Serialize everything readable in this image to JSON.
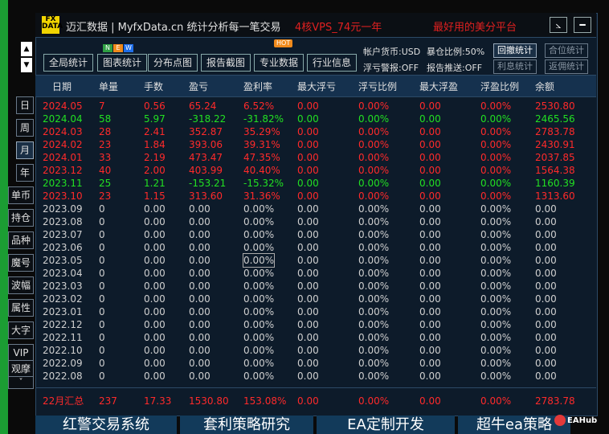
{
  "titlebar": {
    "logo_top": "FX",
    "logo_bottom": "DATA",
    "title": "迈汇数据 | MyfxData.cn   统计分析每一笔交易",
    "ad1": "4核VPS_74元一年",
    "ad2": "最好用的美分平台",
    "btn_resize": "⦣",
    "btn_minimize": "━"
  },
  "toolbar": {
    "buttons": [
      "全局统计",
      "图表统计",
      "分布点图",
      "报告截图",
      "专业数据",
      "行业信息"
    ],
    "new_badge": [
      "N",
      "E",
      "W"
    ],
    "hot_badge": "HOT",
    "currency": "帐户货币:USD",
    "explosion": "暴仓比例:50%",
    "float_alert": "浮亏警报:OFF",
    "report_push": "报告推送:OFF",
    "right_buttons": [
      "回撤统计",
      "合位统计",
      "利息统计",
      "返佣统计"
    ]
  },
  "side": {
    "arrow_up": "▲",
    "arrow_down": "▼",
    "period_buttons": [
      "日",
      "周",
      "月",
      "年"
    ],
    "menu_buttons": [
      "单币",
      "持仓",
      "品种",
      "魔号",
      "波幅",
      "属性",
      "大字",
      "VIP",
      "观摩"
    ],
    "scroll_down": "˅"
  },
  "table": {
    "headers": [
      "日期",
      "单量",
      "手数",
      "盈亏",
      "盈利率",
      "最大浮亏",
      "浮亏比例",
      "最大浮盈",
      "浮盈比例",
      "余额"
    ],
    "rows": [
      {
        "type": "pos",
        "c": [
          "2024.05",
          "7",
          "0.56",
          "65.24",
          "6.52%",
          "0.00",
          "0.00%",
          "0.00",
          "0.00%",
          "2530.80"
        ]
      },
      {
        "type": "neg",
        "c": [
          "2024.04",
          "58",
          "5.97",
          "-318.22",
          "-31.82%",
          "0.00",
          "0.00%",
          "0.00",
          "0.00%",
          "2465.56"
        ]
      },
      {
        "type": "pos",
        "c": [
          "2024.03",
          "28",
          "2.41",
          "352.87",
          "35.29%",
          "0.00",
          "0.00%",
          "0.00",
          "0.00%",
          "2783.78"
        ]
      },
      {
        "type": "pos",
        "c": [
          "2024.02",
          "23",
          "1.84",
          "393.06",
          "39.31%",
          "0.00",
          "0.00%",
          "0.00",
          "0.00%",
          "2430.91"
        ]
      },
      {
        "type": "pos",
        "c": [
          "2024.01",
          "33",
          "2.19",
          "473.47",
          "47.35%",
          "0.00",
          "0.00%",
          "0.00",
          "0.00%",
          "2037.85"
        ]
      },
      {
        "type": "pos",
        "c": [
          "2023.12",
          "40",
          "2.00",
          "403.99",
          "40.40%",
          "0.00",
          "0.00%",
          "0.00",
          "0.00%",
          "1564.38"
        ]
      },
      {
        "type": "neg",
        "c": [
          "2023.11",
          "25",
          "1.21",
          "-153.21",
          "-15.32%",
          "0.00",
          "0.00%",
          "0.00",
          "0.00%",
          "1160.39"
        ]
      },
      {
        "type": "pos",
        "c": [
          "2023.10",
          "23",
          "1.15",
          "313.60",
          "31.36%",
          "0.00",
          "0.00%",
          "0.00",
          "0.00%",
          "1313.60"
        ]
      },
      {
        "type": "zero",
        "c": [
          "2023.09",
          "0",
          "0.00",
          "0.00",
          "0.00%",
          "0.00",
          "0.00%",
          "0.00",
          "0.00%",
          "0.00"
        ]
      },
      {
        "type": "zero",
        "c": [
          "2023.08",
          "0",
          "0.00",
          "0.00",
          "0.00%",
          "0.00",
          "0.00%",
          "0.00",
          "0.00%",
          "0.00"
        ]
      },
      {
        "type": "zero",
        "c": [
          "2023.07",
          "0",
          "0.00",
          "0.00",
          "0.00%",
          "0.00",
          "0.00%",
          "0.00",
          "0.00%",
          "0.00"
        ]
      },
      {
        "type": "zero",
        "c": [
          "2023.06",
          "0",
          "0.00",
          "0.00",
          "0.00%",
          "0.00",
          "0.00%",
          "0.00",
          "0.00%",
          "0.00"
        ]
      },
      {
        "type": "zero",
        "c": [
          "2023.05",
          "0",
          "0.00",
          "0.00",
          "0.00%",
          "0.00",
          "0.00%",
          "0.00",
          "0.00%",
          "0.00"
        ]
      },
      {
        "type": "zero",
        "c": [
          "2023.04",
          "0",
          "0.00",
          "0.00",
          "0.00%",
          "0.00",
          "0.00%",
          "0.00",
          "0.00%",
          "0.00"
        ]
      },
      {
        "type": "zero",
        "c": [
          "2023.03",
          "0",
          "0.00",
          "0.00",
          "0.00%",
          "0.00",
          "0.00%",
          "0.00",
          "0.00%",
          "0.00"
        ]
      },
      {
        "type": "zero",
        "c": [
          "2023.02",
          "0",
          "0.00",
          "0.00",
          "0.00%",
          "0.00",
          "0.00%",
          "0.00",
          "0.00%",
          "0.00"
        ]
      },
      {
        "type": "zero",
        "c": [
          "2023.01",
          "0",
          "0.00",
          "0.00",
          "0.00%",
          "0.00",
          "0.00%",
          "0.00",
          "0.00%",
          "0.00"
        ]
      },
      {
        "type": "zero",
        "c": [
          "2022.12",
          "0",
          "0.00",
          "0.00",
          "0.00%",
          "0.00",
          "0.00%",
          "0.00",
          "0.00%",
          "0.00"
        ]
      },
      {
        "type": "zero",
        "c": [
          "2022.11",
          "0",
          "0.00",
          "0.00",
          "0.00%",
          "0.00",
          "0.00%",
          "0.00",
          "0.00%",
          "0.00"
        ]
      },
      {
        "type": "zero",
        "c": [
          "2022.10",
          "0",
          "0.00",
          "0.00",
          "0.00%",
          "0.00",
          "0.00%",
          "0.00",
          "0.00%",
          "0.00"
        ]
      },
      {
        "type": "zero",
        "c": [
          "2022.09",
          "0",
          "0.00",
          "0.00",
          "0.00%",
          "0.00",
          "0.00%",
          "0.00",
          "0.00%",
          "0.00"
        ]
      },
      {
        "type": "zero",
        "c": [
          "2022.08",
          "0",
          "0.00",
          "0.00",
          "0.00%",
          "0.00",
          "0.00%",
          "0.00",
          "0.00%",
          "0.00"
        ]
      }
    ],
    "summary": [
      "22月汇总",
      "237",
      "17.33",
      "1530.80",
      "153.08%",
      "0.00",
      "0.00%",
      "0.00",
      "0.00%",
      "2783.78"
    ]
  },
  "banners": [
    "红警交易系统",
    "套利策略研究",
    "EA定制开发",
    "超牛ea策略"
  ],
  "watermark": "EAHub",
  "colors": {
    "positive": "#ff2a2a",
    "negative": "#22e022",
    "neutral": "#cfcfcf",
    "panel": "#0d1b2a",
    "header": "#15314e"
  }
}
